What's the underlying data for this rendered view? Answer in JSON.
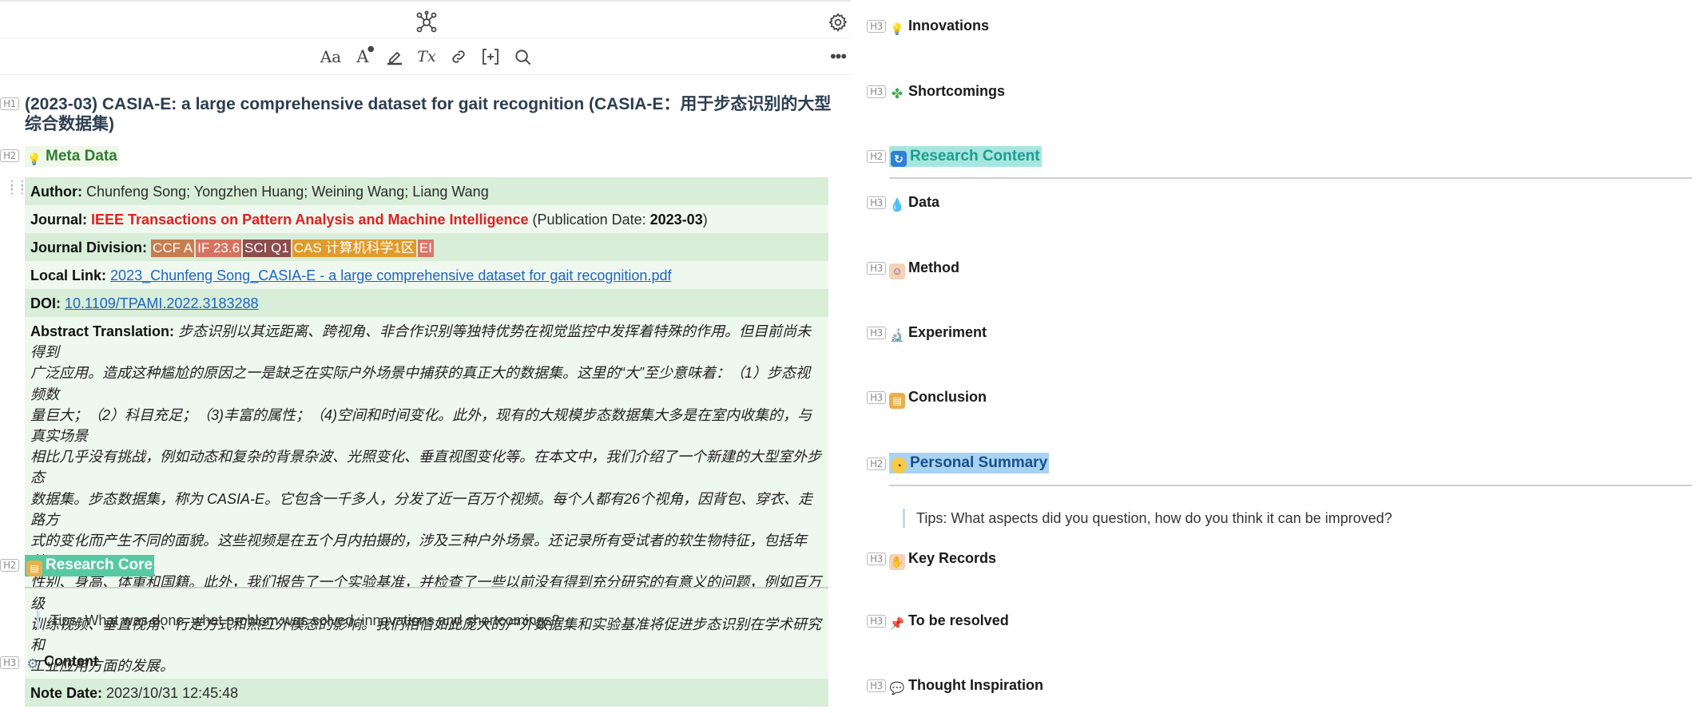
{
  "toolbar": {
    "icons": [
      "graph-icon",
      "gear-icon",
      "font-size-icon",
      "font-color-icon",
      "highlight-icon",
      "clear-format-icon",
      "link-icon",
      "insert-block-icon",
      "search-icon",
      "more-icon"
    ],
    "font_size_label": "Aa",
    "font_color_label": "A",
    "clear_label": "Tx"
  },
  "heading_tags": {
    "h1": "H1",
    "h2": "H2",
    "h3": "H3"
  },
  "document": {
    "title": "(2023-03) CASIA-E: a large comprehensive dataset for gait recognition (CASIA-E：用于步态识别的大型综合数据集)",
    "meta_heading": "Meta Data",
    "meta": {
      "author_label": "Author:",
      "author_value": "Chunfeng Song; Yongzhen Huang; Weining Wang; Liang Wang",
      "journal_label": "Journal:",
      "journal_value": "IEEE Transactions on Pattern Analysis and Machine Intelligence",
      "pubdate_prefix": "(Publication Date:",
      "pubdate_value": "2023-03",
      "pubdate_suffix": ")",
      "division_label": "Journal Division:",
      "division_tags": [
        {
          "text": "CCF A",
          "color": "#c77d4f"
        },
        {
          "text": "IF 23.6",
          "color": "#d4735f"
        },
        {
          "text": "SCI Q1",
          "color": "#8b4d4d"
        },
        {
          "text": "CAS 计算机科学1区",
          "color": "#e09b2d"
        },
        {
          "text": "EI",
          "color": "#d9766a"
        }
      ],
      "local_link_label": "Local Link:",
      "local_link_value": "2023_Chunfeng Song_CASIA-E - a large comprehensive dataset for gait recognition.pdf",
      "doi_label": "DOI:",
      "doi_value": "10.1109/TPAMI.2022.3183288",
      "abstract_label": "Abstract Translation:",
      "abstract_lines": [
        "步态识别以其远距离、跨视角、非合作识别等独特优势在视觉监控中发挥着特殊的作用。但目前尚未得到",
        "广泛应用。造成这种尴尬的原因之一是缺乏在实际户外场景中捕获的真正大的数据集。这里的“大”至少意味着：（1）步态视频数",
        "量巨大；（2）科目充足；（3)丰富的属性；（4)空间和时间变化。此外，现有的大规模步态数据集大多是在室内收集的，与真实场景",
        "相比几乎没有挑战，例如动态和复杂的背景杂波、光照变化、垂直视图变化等。在本文中，我们介绍了一个新建的大型室外步态",
        "数据集。步态数据集，称为 CASIA-E。它包含一千多人，分发了近一百万个视频。每个人都有26个视角，因背包、穿衣、走路方",
        "式的变化而产生不同的面貌。这些视频是在五个月内拍摄的，涉及三种户外场景。还记录所有受试者的软生物特征，包括年龄、",
        "性别、身高、体重和国籍。此外，我们报告了一个实验基准，并检查了一些以前没有得到充分研究的有意义的问题，例如百万级",
        "训练视频、垂直视角、行走方式和热红外模态的影响。我们相信如此庞大的户外数据集和实验基准将促进步态识别在学术研究和",
        "工业应用方面的发展。"
      ],
      "note_label": "Note Date:",
      "note_value": "2023/10/31 12:45:48"
    },
    "research_core_heading": "Research Core",
    "research_core_tip": "Tips: What was done, what problem was solved, innovations and shortcomings?",
    "content_heading": "Content",
    "innovations_heading": "Innovations",
    "shortcomings_heading": "Shortcomings",
    "research_content_heading": "Research Content",
    "data_heading": "Data",
    "method_heading": "Method",
    "experiment_heading": "Experiment",
    "conclusion_heading": "Conclusion",
    "personal_summary_heading": "Personal Summary",
    "personal_summary_tip": "Tips: What aspects did you question, how do you think it can be improved?",
    "key_records_heading": "Key Records",
    "to_be_resolved_heading": "To be resolved",
    "thought_inspiration_heading": "Thought Inspiration"
  },
  "colors": {
    "meta_heading": "#2e7d32",
    "meta_heading_bg": "#eef7e8",
    "research_core_bg": "#56c9a3",
    "research_content_bg": "#a7e6e0",
    "research_content_text": "#1b9e8f",
    "personal_summary_bg": "#a8d3f2",
    "personal_summary_text": "#1a4f8a",
    "journal_red": "#e02020"
  }
}
